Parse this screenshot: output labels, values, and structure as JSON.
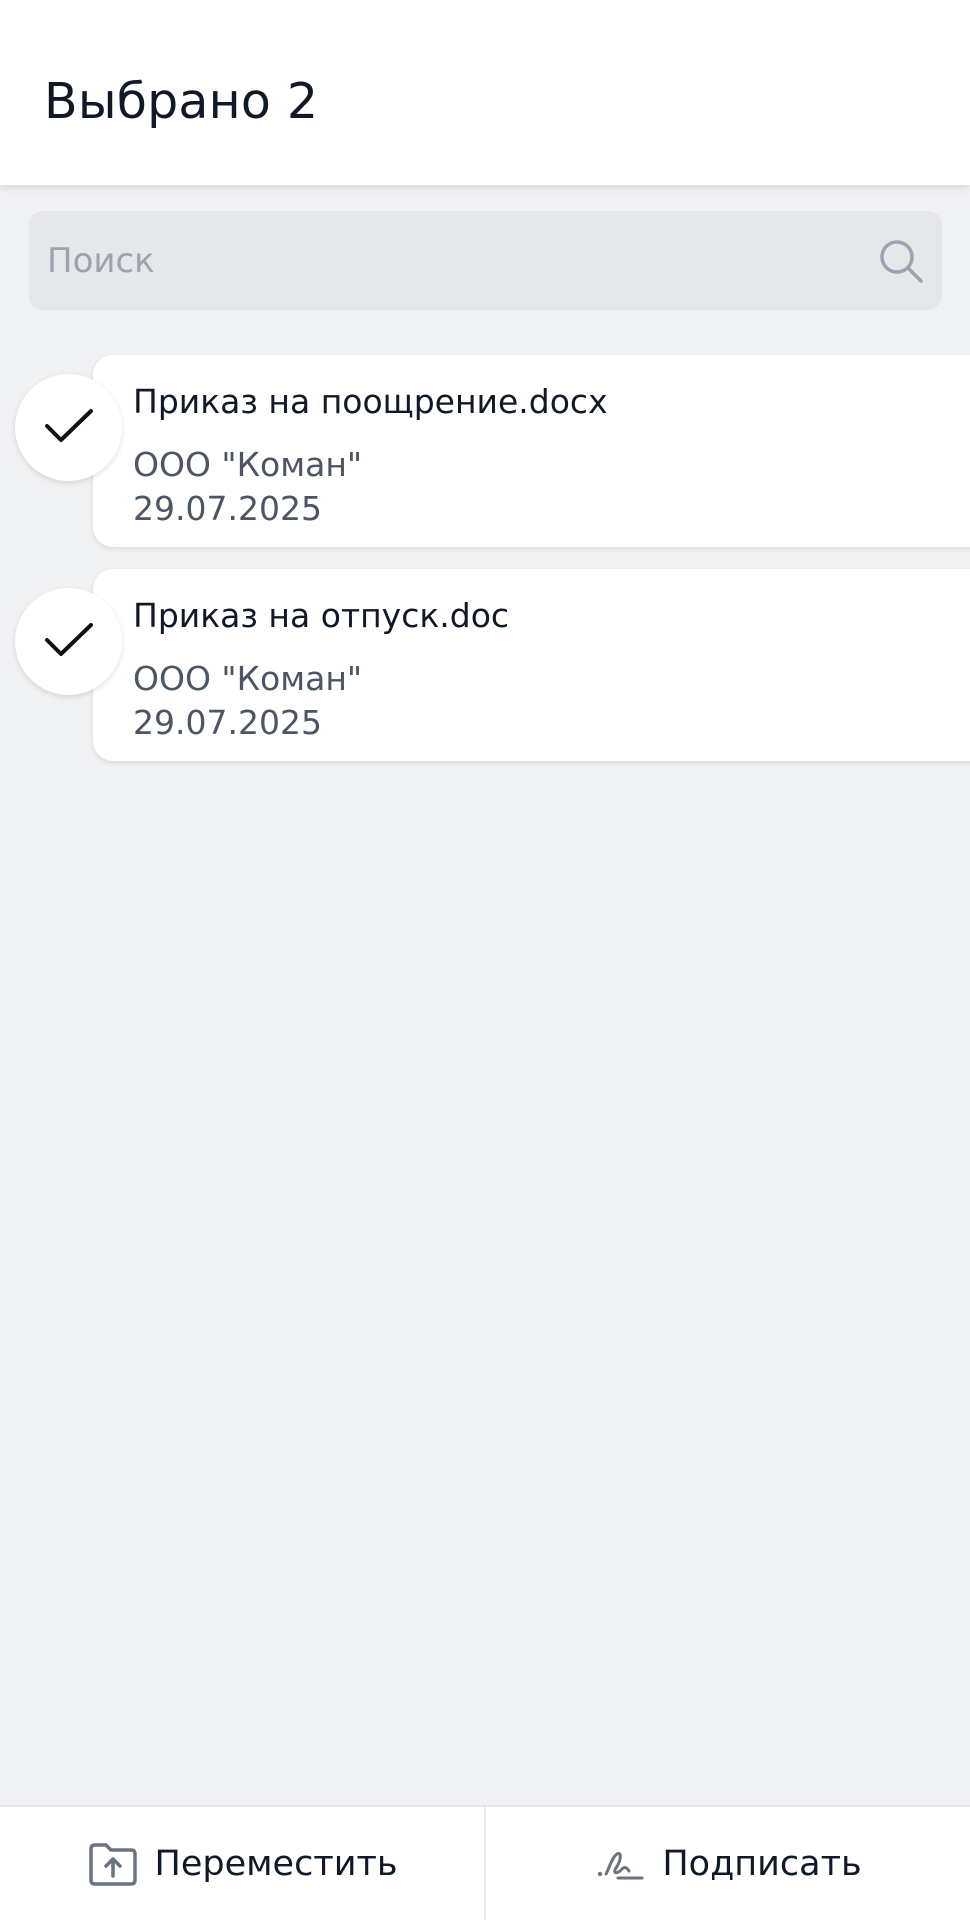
{
  "header": {
    "title": "Выбрано 2"
  },
  "search": {
    "placeholder": "Поиск",
    "value": "",
    "icon": "search-icon"
  },
  "documents": [
    {
      "title": "Приказ на поощрение.docx",
      "organization": "ООО \"Коман\"",
      "date": "29.07.2025",
      "selected": true
    },
    {
      "title": "Приказ на отпуск.doc",
      "organization": "ООО \"Коман\"",
      "date": "29.07.2025",
      "selected": true
    }
  ],
  "actions": {
    "move": {
      "label": "Переместить",
      "icon": "folder-upload-icon"
    },
    "sign": {
      "label": "Подписать",
      "icon": "signature-icon"
    }
  },
  "colors": {
    "background": "#F1F2F4",
    "surface": "#FFFFFF",
    "search_bg": "#E5E7EB",
    "text_primary": "#111827",
    "text_secondary": "#4B5563",
    "placeholder": "#9CA3AF"
  }
}
